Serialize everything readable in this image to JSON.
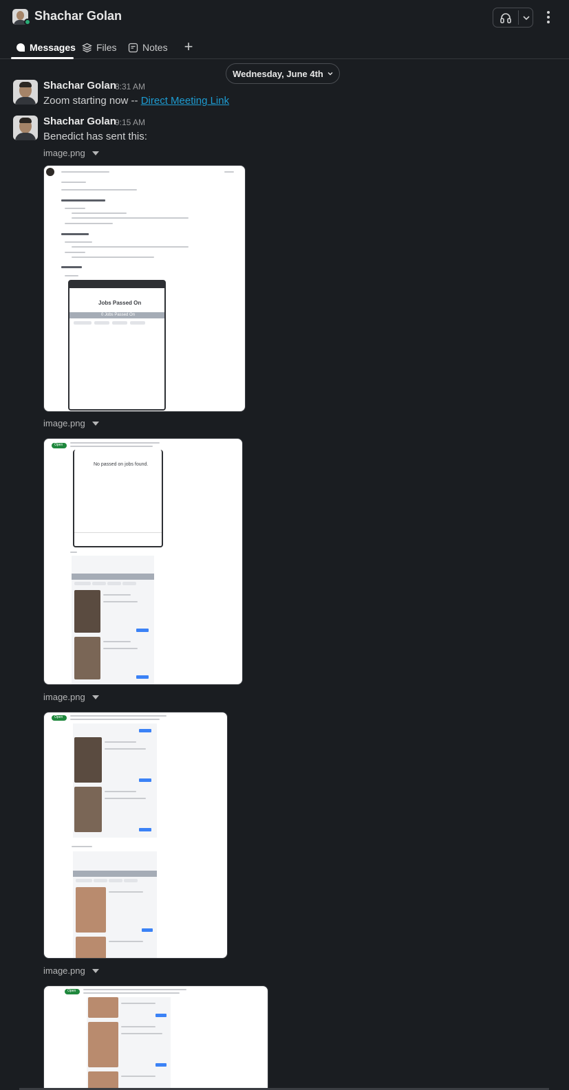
{
  "header": {
    "title": "Shachar Golan"
  },
  "tabs": [
    {
      "label": "Messages",
      "icon": "message-bubble-icon",
      "active": true
    },
    {
      "label": "Files",
      "icon": "layers-icon",
      "active": false
    },
    {
      "label": "Notes",
      "icon": "note-icon",
      "active": false
    }
  ],
  "date_divider": "Wednesday, June 4th",
  "messages": [
    {
      "author": "Shachar Golan",
      "time": "8:31 AM",
      "text": "Zoom starting now -- ",
      "link": "Direct Meeting Link"
    },
    {
      "author": "Shachar Golan",
      "time": "9:15 AM",
      "text": "Benedict has sent this:",
      "files": [
        {
          "label": "image.png"
        },
        {
          "label": "image.png"
        },
        {
          "label": "image.png"
        },
        {
          "label": "image.png"
        }
      ]
    }
  ],
  "screenshot_text": {
    "img1_phone_title": "Jobs Passed On",
    "img1_phone_bar": "0 Jobs Passed On",
    "img2_empty": "No passed on jobs found.",
    "open_badge": "Open"
  },
  "colors": {
    "background": "#1a1d21",
    "link": "#1d9bd1",
    "presence": "#2bac76"
  }
}
